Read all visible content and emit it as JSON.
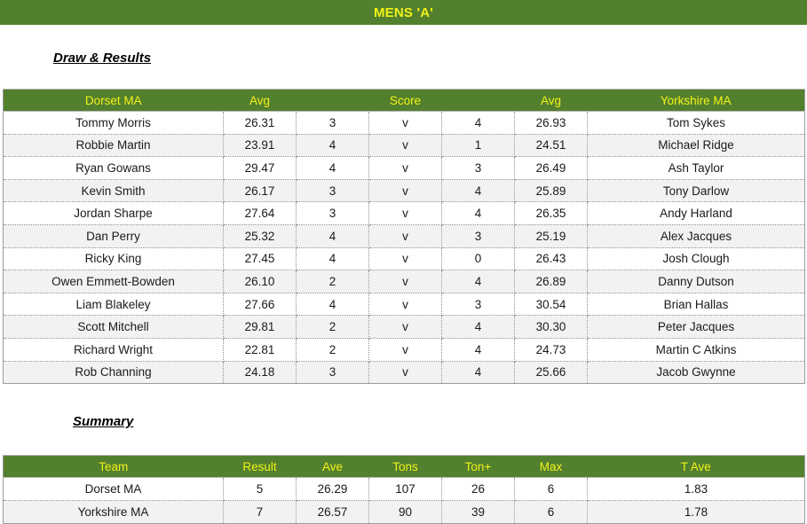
{
  "banner": {
    "title": "MENS 'A'"
  },
  "sections": {
    "draw_heading": "Draw & Results",
    "summary_heading": "Summary"
  },
  "colors": {
    "banner_green": "#53802e",
    "banner_text_yellow": "#f2f218",
    "row_stripe": "#f2f2f2",
    "grid_line": "#8c8c8c",
    "table_border": "#9c9c9c"
  },
  "draw": {
    "headers": [
      "Dorset MA",
      "Avg",
      "",
      "Score",
      "",
      "Avg",
      "Yorkshire MA"
    ],
    "rows": [
      {
        "home_player": "Tommy Morris",
        "home_avg": "26.31",
        "home_score": "3",
        "v": "v",
        "away_score": "4",
        "away_avg": "26.93",
        "away_player": "Tom Sykes"
      },
      {
        "home_player": "Robbie Martin",
        "home_avg": "23.91",
        "home_score": "4",
        "v": "v",
        "away_score": "1",
        "away_avg": "24.51",
        "away_player": "Michael Ridge"
      },
      {
        "home_player": "Ryan Gowans",
        "home_avg": "29.47",
        "home_score": "4",
        "v": "v",
        "away_score": "3",
        "away_avg": "26.49",
        "away_player": "Ash Taylor"
      },
      {
        "home_player": "Kevin Smith",
        "home_avg": "26.17",
        "home_score": "3",
        "v": "v",
        "away_score": "4",
        "away_avg": "25.89",
        "away_player": "Tony Darlow"
      },
      {
        "home_player": "Jordan Sharpe",
        "home_avg": "27.64",
        "home_score": "3",
        "v": "v",
        "away_score": "4",
        "away_avg": "26.35",
        "away_player": "Andy Harland"
      },
      {
        "home_player": "Dan Perry",
        "home_avg": "25.32",
        "home_score": "4",
        "v": "v",
        "away_score": "3",
        "away_avg": "25.19",
        "away_player": "Alex Jacques"
      },
      {
        "home_player": "Ricky King",
        "home_avg": "27.45",
        "home_score": "4",
        "v": "v",
        "away_score": "0",
        "away_avg": "26.43",
        "away_player": "Josh Clough"
      },
      {
        "home_player": "Owen Emmett-Bowden",
        "home_avg": "26.10",
        "home_score": "2",
        "v": "v",
        "away_score": "4",
        "away_avg": "26.89",
        "away_player": "Danny Dutson"
      },
      {
        "home_player": "Liam Blakeley",
        "home_avg": "27.66",
        "home_score": "4",
        "v": "v",
        "away_score": "3",
        "away_avg": "30.54",
        "away_player": "Brian Hallas"
      },
      {
        "home_player": "Scott Mitchell",
        "home_avg": "29.81",
        "home_score": "2",
        "v": "v",
        "away_score": "4",
        "away_avg": "30.30",
        "away_player": "Peter Jacques"
      },
      {
        "home_player": "Richard Wright",
        "home_avg": "22.81",
        "home_score": "2",
        "v": "v",
        "away_score": "4",
        "away_avg": "24.73",
        "away_player": "Martin C Atkins"
      },
      {
        "home_player": "Rob Channing",
        "home_avg": "24.18",
        "home_score": "3",
        "v": "v",
        "away_score": "4",
        "away_avg": "25.66",
        "away_player": "Jacob Gwynne"
      }
    ]
  },
  "summary": {
    "headers": [
      "Team",
      "Result",
      "Ave",
      "Tons",
      "Ton+",
      "Max",
      "T Ave"
    ],
    "rows": [
      {
        "team": "Dorset MA",
        "result": "5",
        "ave": "26.29",
        "tons": "107",
        "ton_plus": "26",
        "max": "6",
        "t_ave": "1.83"
      },
      {
        "team": "Yorkshire MA",
        "result": "7",
        "ave": "26.57",
        "tons": "90",
        "ton_plus": "39",
        "max": "6",
        "t_ave": "1.78"
      }
    ]
  }
}
